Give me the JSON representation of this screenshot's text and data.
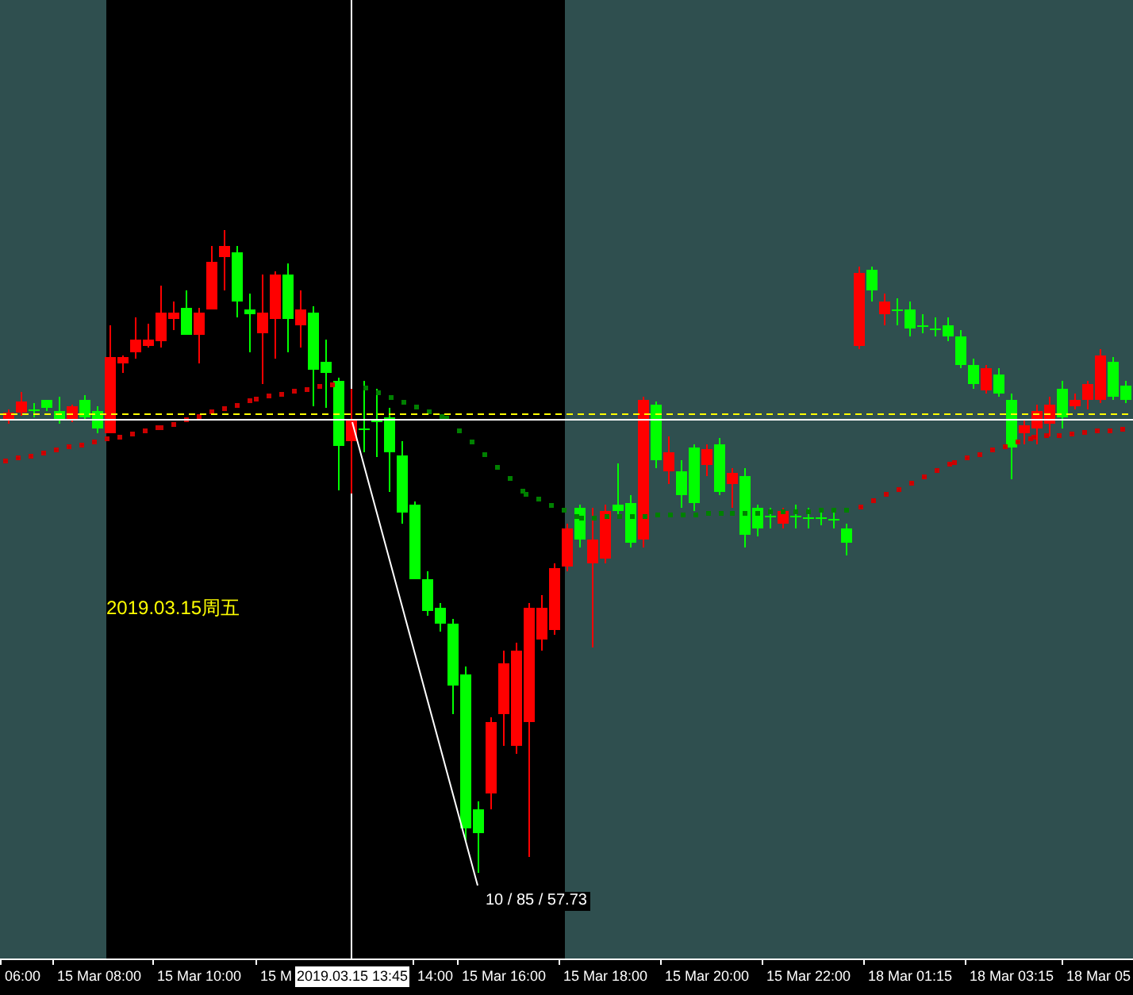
{
  "chart": {
    "date_label": "2019.03.15周五",
    "measure_label": "10 / 85 / 57.73"
  },
  "crosshair": {
    "time_label": "2019.03.15 13:45"
  },
  "x_axis": {
    "labels": [
      "06:00",
      "15 Mar 08:00",
      "15 Mar 10:00",
      "15 M",
      "14:00",
      "15 Mar 16:00",
      "15 Mar 18:00",
      "15 Mar 20:00",
      "15 Mar 22:00",
      "18 Mar 01:15",
      "18 Mar 03:15",
      "18 Mar 05"
    ]
  }
}
